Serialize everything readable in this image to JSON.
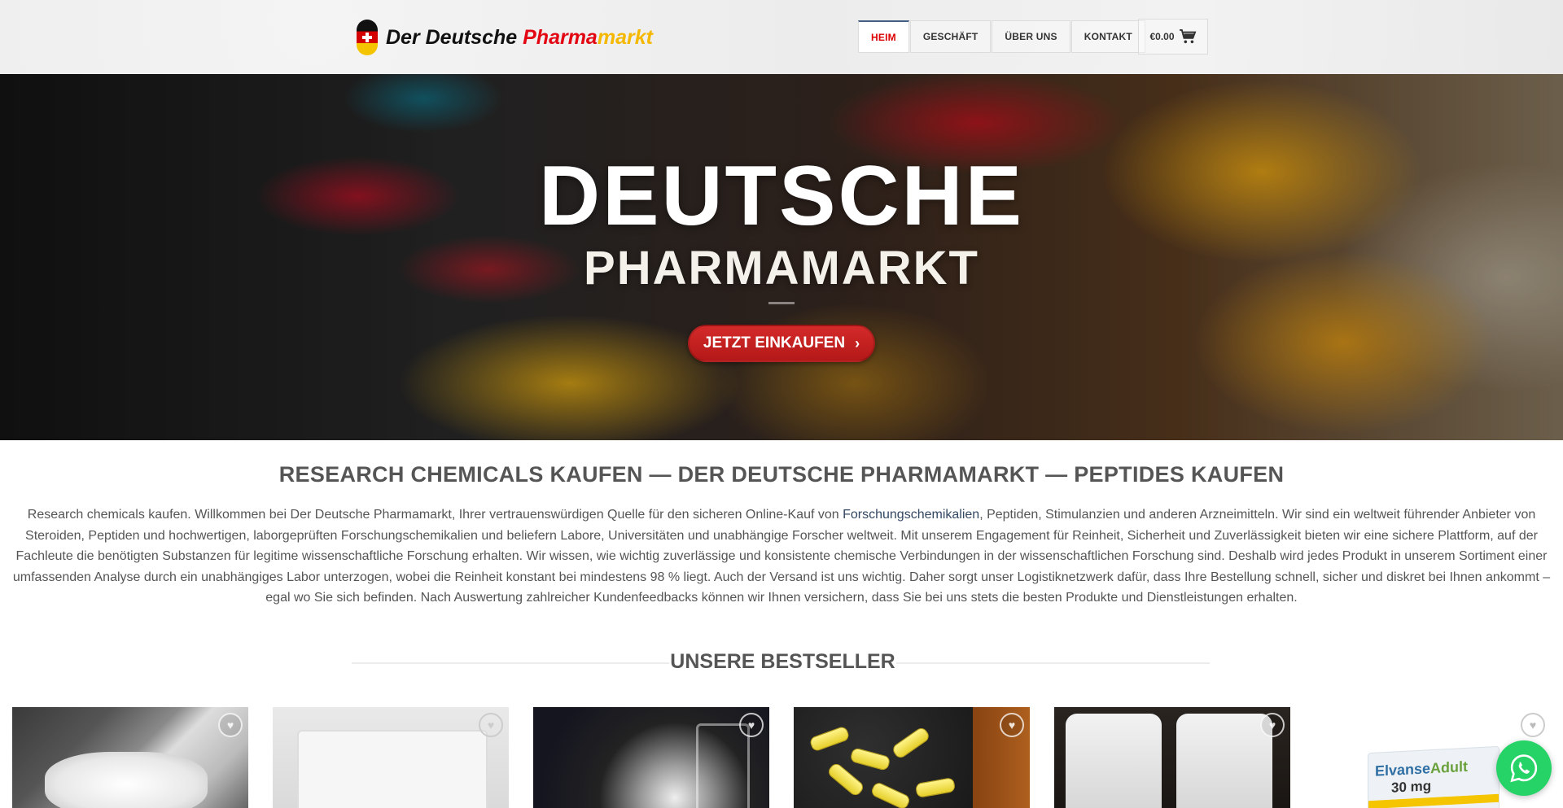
{
  "header": {
    "logo": {
      "part1": "Der Deutsche ",
      "part2": "Pharma",
      "part3": "markt"
    },
    "nav": [
      {
        "label": "HEIM",
        "active": true
      },
      {
        "label": "GESCHÄFT",
        "active": false
      },
      {
        "label": "ÜBER UNS",
        "active": false
      },
      {
        "label": "KONTAKT",
        "active": false
      }
    ],
    "cart": {
      "total": "€0.00",
      "icon": "cart-icon"
    }
  },
  "hero": {
    "title": "DEUTSCHE",
    "subtitle": "PHARMAMARKT",
    "button_label": "JETZT EINKAUFEN",
    "button_icon": "chevron-right-icon"
  },
  "intro": {
    "heading": "RESEARCH CHEMICALS KAUFEN — DER DEUTSCHE PHARMAMARKT — PEPTIDES KAUFEN",
    "text_before_link": "Research chemicals kaufen. Willkommen bei Der Deutsche Pharmamarkt, Ihrer vertrauenswürdigen Quelle für den sicheren Online-Kauf von ",
    "link_text": "Forschungschemikalien",
    "text_after_link": ", Peptiden, Stimulanzien und anderen Arzneimitteln. Wir sind ein weltweit führender Anbieter von Steroiden, Peptiden und hochwertigen, laborgeprüften Forschungschemikalien und beliefern Labore, Universitäten und unabhängige Forscher weltweit. Mit unserem Engagement für Reinheit, Sicherheit und Zuverlässigkeit bieten wir eine sichere Plattform, auf der Fachleute die benötigten Substanzen für legitime wissenschaftliche Forschung erhalten. Wir wissen, wie wichtig zuverlässige und konsistente chemische Verbindungen in der wissenschaftlichen Forschung sind. Deshalb wird jedes Produkt in unserem Sortiment einer umfassenden Analyse durch ein unabhängiges Labor unterzogen, wobei die Reinheit konstant bei mindestens 98 % liegt. Auch der Versand ist uns wichtig. Daher sorgt unser Logistiknetzwerk dafür, dass Ihre Bestellung schnell, sicher und diskret bei Ihnen ankommt – egal wo Sie sich befinden. Nach Auswertung zahlreicher Kundenfeedbacks können wir Ihnen versichern, dass Sie bei uns stets die besten Produkte und Dienstleistungen erhalten."
  },
  "bestsellers": {
    "title": "UNSERE BESTSELLER",
    "products": [
      {
        "icon": "heart-icon"
      },
      {
        "icon": "heart-icon"
      },
      {
        "icon": "heart-icon"
      },
      {
        "icon": "heart-icon"
      },
      {
        "icon": "heart-icon"
      },
      {
        "icon": "heart-icon",
        "box_brand": "Elvanse",
        "box_brand_suffix": "Adult",
        "box_dose": "30 mg"
      }
    ]
  },
  "floating": {
    "whatsapp_icon": "whatsapp-icon"
  },
  "colors": {
    "accent_red": "#d42a2a",
    "nav_active_border": "#446084",
    "brand_yellow": "#f5b800",
    "whatsapp_green": "#25d366"
  }
}
